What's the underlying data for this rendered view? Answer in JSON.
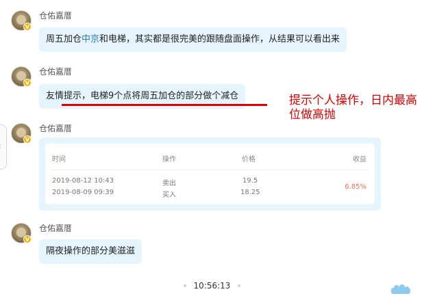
{
  "messages": [
    {
      "sender": "仓佑嘉厝",
      "badge": "V",
      "text_before": "周五加仓",
      "text_link": "中京",
      "text_after": "和电梯，其实都是很完美的跟随盘面操作，从结果可以看出来"
    },
    {
      "sender": "仓佑嘉厝",
      "badge": "V",
      "text": "友情提示，电梯9个点将周五加仓的部分做个减仓"
    },
    {
      "sender": "仓佑嘉厝",
      "badge": "V"
    },
    {
      "sender": "仓佑嘉厝",
      "badge": "V",
      "text": "隔夜操作的部分美滋滋"
    }
  ],
  "annotation": "提示个人操作，日内最高位做高抛",
  "trade_table": {
    "headers": {
      "time": "时间",
      "action": "操作",
      "price": "价格",
      "profit": "收益"
    },
    "rows": [
      {
        "time": "2019-08-12 10:43",
        "action": "卖出",
        "price": "19.5"
      },
      {
        "time": "2019-08-09 09:39",
        "action": "买入",
        "price": "18.25"
      }
    ],
    "profit": "6.85%"
  },
  "timestamp": "10:56:13",
  "colors": {
    "bubble": "#e6f4fd",
    "link": "#2b79c2",
    "annotation_red": "#e00000",
    "profit": "#f06b5b"
  },
  "icons": [
    "avatar",
    "v-badge",
    "chevron-left-icon",
    "cloud-icon"
  ]
}
